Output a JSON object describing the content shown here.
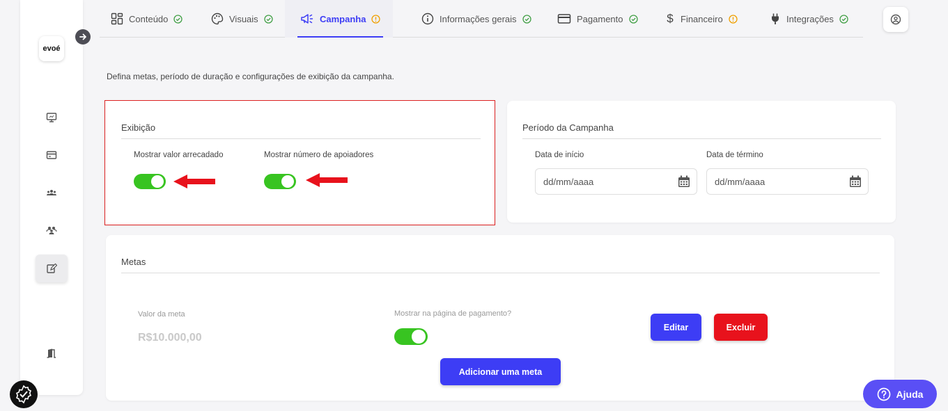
{
  "brand": {
    "logo_text": "evoé"
  },
  "tabs": [
    {
      "label": "Conteúdo",
      "icon": "grid-icon",
      "status": "ok"
    },
    {
      "label": "Visuais",
      "icon": "palette-icon",
      "status": "ok"
    },
    {
      "label": "Campanha",
      "icon": "megaphone-icon",
      "status": "warning"
    },
    {
      "label": "Informações gerais",
      "icon": "info-icon",
      "status": "ok"
    },
    {
      "label": "Pagamento",
      "icon": "credit-card-icon",
      "status": "ok"
    },
    {
      "label": "Financeiro",
      "icon": "dollar-icon",
      "status": "warning"
    },
    {
      "label": "Integrações",
      "icon": "plug-icon",
      "status": "ok"
    }
  ],
  "colors": {
    "ok": "#43a047",
    "warning": "#f0a000",
    "accent": "#3d3df5",
    "danger": "#e8121c",
    "toggle_on": "#38c421"
  },
  "intro": "Defina metas, período de duração e configurações de exibição da campanha.",
  "exibicao": {
    "title": "Exibição",
    "toggle1_label": "Mostrar valor arrecadado",
    "toggle1_on": true,
    "toggle2_label": "Mostrar número de apoiadores",
    "toggle2_on": true
  },
  "periodo": {
    "title": "Período da Campanha",
    "start_label": "Data de início",
    "start_placeholder": "dd/mm/aaaa",
    "end_label": "Data de término",
    "end_placeholder": "dd/mm/aaaa"
  },
  "metas": {
    "title": "Metas",
    "value_label": "Valor da meta",
    "value": "R$10.000,00",
    "show_label": "Mostrar na página de pagamento?",
    "show_on": true,
    "edit_label": "Editar",
    "delete_label": "Excluir",
    "add_label": "Adicionar uma meta"
  },
  "help": {
    "label": "Ajuda"
  }
}
